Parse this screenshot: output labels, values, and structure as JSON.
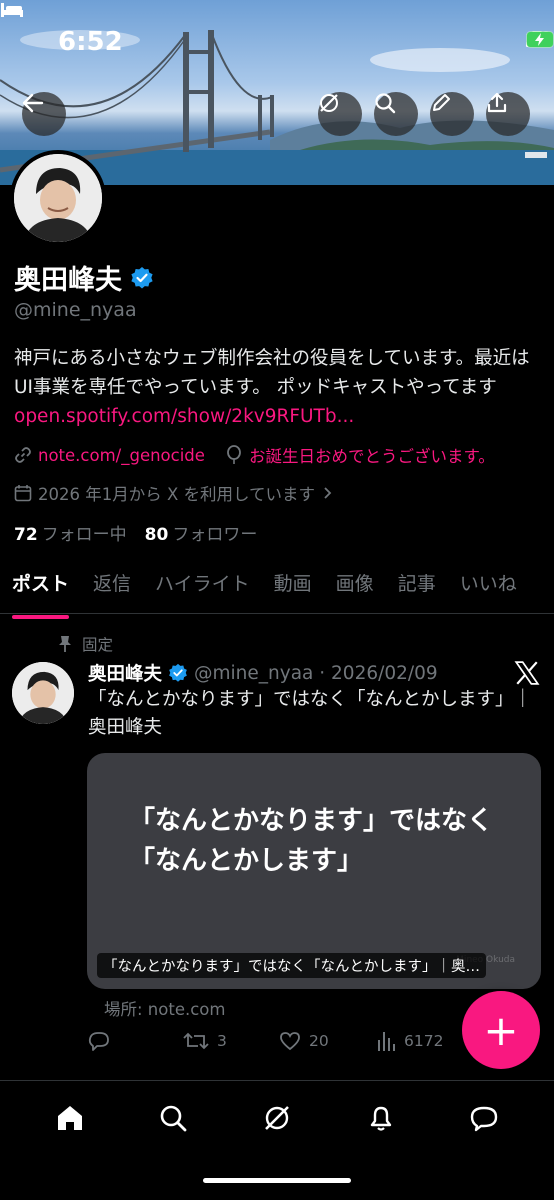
{
  "status_bar": {
    "time": "6:52",
    "signal_icon": "signal-icon",
    "wifi_icon": "wifi-icon",
    "battery_icon": "battery-charging-icon"
  },
  "header_buttons": [
    "back-icon",
    "grok-icon",
    "search-icon",
    "edit-icon",
    "share-icon"
  ],
  "profile": {
    "name": "奥田峰夫",
    "handle": "@mine_nyaa",
    "bio": "神戸にある小さなウェブ制作会社の役員をしています。最近はUI事業を専任でやっています。 ポッドキャストやってます ",
    "bio_link": "open.spotify.com/show/2kv9RFUTb...",
    "website": "note.com/_genocide",
    "birthday": "お誕生日おめでとうございます。",
    "joined": "2026 年1月から X を利用しています",
    "following_count": "72",
    "following_label": "フォロー中",
    "followers_count": "80",
    "followers_label": "フォロワー"
  },
  "tabs": [
    "ポスト",
    "返信",
    "ハイライト",
    "動画",
    "画像",
    "記事",
    "いいね"
  ],
  "active_tab": "ポスト",
  "post": {
    "pinned_label": "固定",
    "author": "奥田峰夫",
    "meta": "@mine_nyaa · 2026/02/09",
    "text": "「なんとかなります」ではなく「なんとかします」｜奥田峰夫",
    "card_title": "「なんとかなります」ではなく「なんとかします」",
    "card_caption": "「なんとかなります」ではなく「なんとかします」｜奥…",
    "card_watermark": "Mineo Okuda",
    "place": "場所: note.com",
    "replies": "",
    "reposts": "3",
    "likes": "20",
    "views": "6172"
  },
  "fab_label": "+",
  "bottom_nav": [
    "home-icon",
    "search-icon",
    "grok-icon",
    "notifications-icon",
    "messages-icon"
  ],
  "colors": {
    "accent": "#f91880",
    "background": "#000000",
    "secondary_text": "#71767b",
    "verified": "#1d9bf0"
  }
}
